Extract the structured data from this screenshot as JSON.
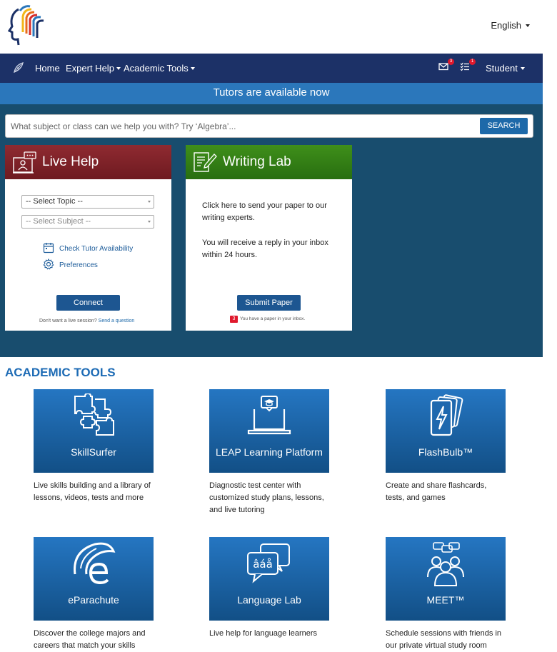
{
  "header": {
    "language": "English"
  },
  "nav": {
    "home": "Home",
    "expert_help": "Expert Help",
    "academic_tools": "Academic Tools",
    "mail_count": "3",
    "tasks_count": "1",
    "account": "Student"
  },
  "hero": {
    "availability": "Tutors are available now",
    "search_placeholder": "What subject or class can we help you with? Try ‘Algebra’...",
    "search_button": "SEARCH"
  },
  "live_help": {
    "title": "Live Help",
    "topic_select": "-- Select Topic --",
    "subject_select": "-- Select Subject --",
    "check_availability": "Check Tutor Availability",
    "preferences": "Preferences",
    "connect": "Connect",
    "note": "Don't want a live session?",
    "note_link": "Send a question"
  },
  "writing_lab": {
    "title": "Writing Lab",
    "text1": "Click here to send your paper to our writing experts.",
    "text2": "You will receive a reply in your inbox within 24 hours.",
    "submit": "Submit Paper",
    "inbox_count": "3",
    "inbox_note": "You have a paper in your inbox."
  },
  "academic_tools": {
    "heading": "ACADEMIC TOOLS",
    "items": [
      {
        "name": "SkillSurfer",
        "icon": "puzzle-icon",
        "desc": "Live skills building and a library of lessons, videos, tests and more"
      },
      {
        "name": "LEAP Learning Platform",
        "icon": "laptop-graduation-icon",
        "desc": "Diagnostic test center with customized study plans, lessons, and live tutoring"
      },
      {
        "name": "FlashBulb™",
        "icon": "flashcards-icon",
        "desc": "Create and share flashcards, tests, and games"
      },
      {
        "name": "eParachute",
        "icon": "parachute-e-icon",
        "desc": "Discover the college majors and careers that match your skills"
      },
      {
        "name": "Language Lab",
        "icon": "speech-bubbles-icon",
        "desc": "Live help for language learners"
      },
      {
        "name": "MEET™",
        "icon": "group-meeting-icon",
        "desc": "Schedule sessions with friends in our private virtual study room"
      }
    ]
  },
  "colors": {
    "navbar": "#1c3167",
    "availability_bar": "#2b77bb",
    "hero_background": "#184d6e",
    "live_help_header": "#8f2a31",
    "writing_lab_header": "#3f8f1a",
    "tool_tile": "#1d63a6",
    "heading_blue": "#1d6bb5"
  }
}
